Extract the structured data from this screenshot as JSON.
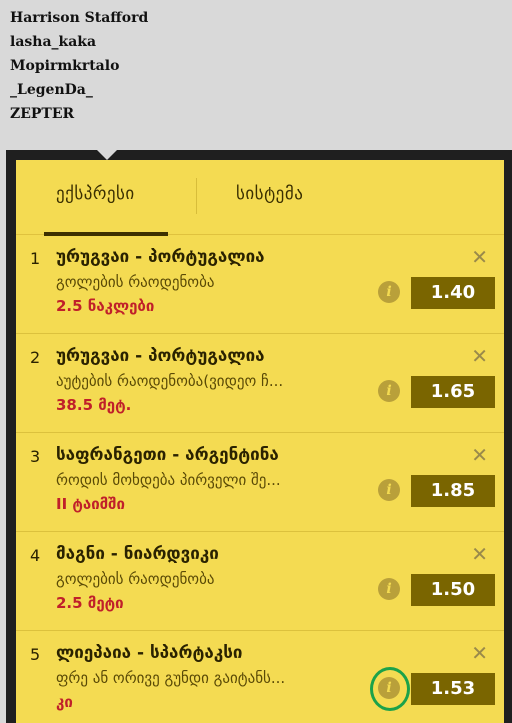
{
  "users": [
    "Harrison Stafford",
    "lasha_kaka",
    "Mopirmkrtalo",
    "_LegenDa_",
    "ZEPTER"
  ],
  "tabs": {
    "express": "ექსპრესი",
    "system": "სისტემა"
  },
  "bets": [
    {
      "num": "1",
      "match": "ურუგვაი - პორტუგალია",
      "market": "გოლების რაოდენობა",
      "selection": "2.5 ნაკლები",
      "odds": "1.40"
    },
    {
      "num": "2",
      "match": "ურუგვაი - პორტუგალია",
      "market": "აუტების რაოდენობა(ვიდეო ჩ...",
      "selection": "38.5 მეტ.",
      "odds": "1.65"
    },
    {
      "num": "3",
      "match": "საფრანგეთი - არგენტინა",
      "market": "როდის მოხდება პირველი შე...",
      "selection": "II ტაიმში",
      "odds": "1.85"
    },
    {
      "num": "4",
      "match": "მაგნი - ნიარდვიკი",
      "market": "გოლების რაოდენობა",
      "selection": "2.5 მეტი",
      "odds": "1.50"
    },
    {
      "num": "5",
      "match": "ლიეპაია - სპარტაკსი",
      "market": "ფრე ან ორივე გუნდი გაიტანს...",
      "selection": "კი",
      "odds": "1.53"
    }
  ],
  "icons": {
    "close": "close-icon",
    "info": "info-icon"
  },
  "colors": {
    "slip": "#f4db52",
    "odds_bg": "#7a6500",
    "selection": "#c0202a",
    "highlight": "#1ca24a"
  }
}
